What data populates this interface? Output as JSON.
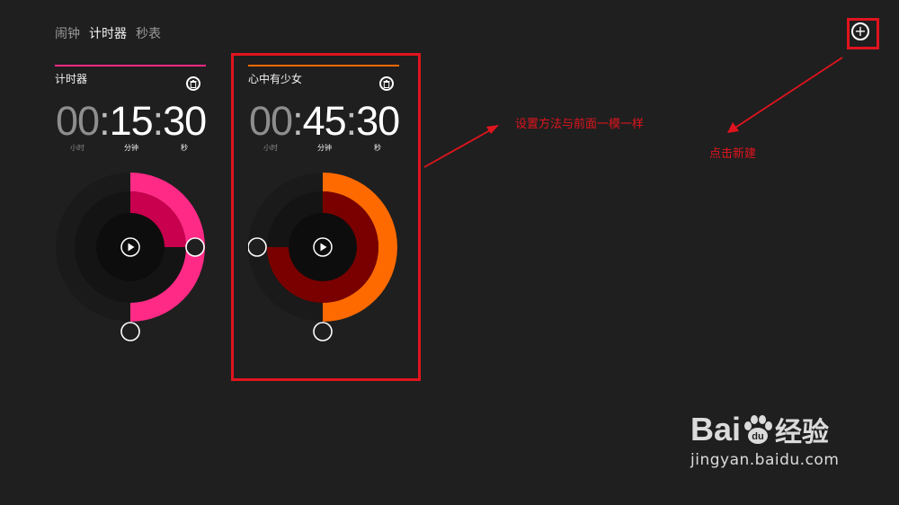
{
  "tabs": [
    {
      "label": "闹钟",
      "active": false
    },
    {
      "label": "计时器",
      "active": true
    },
    {
      "label": "秒表",
      "active": false
    }
  ],
  "add_button": {
    "label": "+",
    "icon": "plus-circle-icon"
  },
  "timers": [
    {
      "name": "计时器",
      "hours": "00",
      "minutes": "15",
      "seconds": "30",
      "unit_hours": "小时",
      "unit_minutes": "分钟",
      "unit_seconds": "秒",
      "accent": "#ff2a85",
      "accent_dark": "#c8004e",
      "play_icon": "play-icon",
      "delete_icon": "trash-icon",
      "minutes_fraction": 0.25,
      "seconds_fraction": 0.5
    },
    {
      "name": "心中有少女",
      "hours": "00",
      "minutes": "45",
      "seconds": "30",
      "unit_hours": "小时",
      "unit_minutes": "分钟",
      "unit_seconds": "秒",
      "accent": "#ff6a00",
      "accent_dark": "#7a0000",
      "play_icon": "play-icon",
      "delete_icon": "trash-icon",
      "minutes_fraction": 0.75,
      "seconds_fraction": 0.5
    }
  ],
  "annotations": {
    "same_setup": "设置方法与前面一模一样",
    "click_new": "点击新建",
    "highlight_color": "#e0141e"
  },
  "watermark": {
    "logo_left": "Bai",
    "logo_mid": "du",
    "logo_right": "经验",
    "url": "jingyan.baidu.com"
  }
}
